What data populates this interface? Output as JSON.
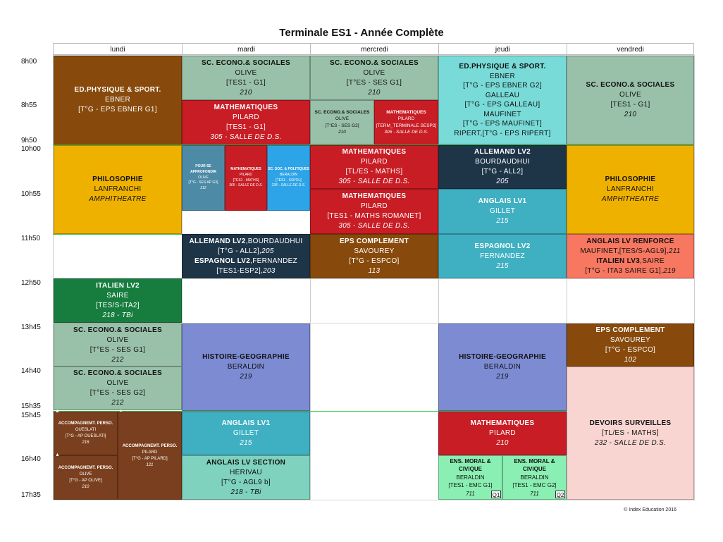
{
  "title": "Terminale ES1 - Année Complète",
  "days": [
    "lundi",
    "mardi",
    "mercredi",
    "jeudi",
    "vendredi"
  ],
  "times": [
    "8h00",
    "8h55",
    "9h50",
    "10h00",
    "10h55",
    "11h50",
    "12h50",
    "13h45",
    "14h40",
    "15h35",
    "15h45",
    "16h40",
    "17h35"
  ],
  "footer": "© Index Education 2016",
  "colors": {
    "brown": "#874a0c",
    "sage": "#99c1a9",
    "red": "#c81d25",
    "cyan": "#78dbd8",
    "gold": "#efb100",
    "steel": "#4d8aa6",
    "sky": "#2ea4e8",
    "navy": "#1e3548",
    "teal": "#3fb0c2",
    "salmon": "#f77761",
    "green": "#177d3f",
    "periwinkle": "#7d8bd3",
    "pink": "#f9d5d2",
    "mint": "#8aefb2",
    "dkbrown": "#7a3f1e",
    "aqua": "#7fd3be"
  },
  "events": {
    "mon_eps": [
      "ED.PHYSIQUE & SPORT.",
      "EBNER",
      "[T°G - EPS EBNER G1]"
    ],
    "mon_philo": [
      "PHILOSOPHIE",
      "LANFRANCHI",
      "AMPHITHEATRE"
    ],
    "mon_ital": [
      "ITALIEN LV2",
      "SAIRE",
      "[TES/S-ITA2]",
      "218 - TBi"
    ],
    "mon_ses1": [
      "SC. ECONO.& SOCIALES",
      "OLIVE",
      "[T°ES - SES G1]",
      "212"
    ],
    "mon_ses2": [
      "SC. ECONO.& SOCIALES",
      "OLIVE",
      "[T°ES - SES G2]",
      "212"
    ],
    "mon_ap1": [
      "ACCOMPAGNEMT. PERSO.",
      "OUESLATI",
      "[T°G - AP OUESLATI]",
      "216"
    ],
    "mon_ap2": [
      "ACCOMPAGNEMT. PERSO.",
      "PILARD",
      "[T°G - AP PILARD]",
      "121"
    ],
    "mon_ap3": [
      "ACCOMPAGNEMT. PERSO.",
      "OLIVE",
      "[T°G - AP OLIVE]",
      "210"
    ],
    "tue_ses": [
      "SC. ECONO.& SOCIALES",
      "OLIVE",
      "[TES1 - G1]",
      "210"
    ],
    "tue_math": [
      "MATHEMATIQUES",
      "PILARD",
      "[TES1 - G1]",
      "305 - SALLE DE D.S."
    ],
    "tue_appro": [
      "POUR SE APPROFONDIR",
      "OLIVE",
      "[T°G - SES AP G3]",
      "212"
    ],
    "tue_math2": [
      "MATHEMATIQUES",
      "PILARD",
      "[TES1 - MATHS]",
      "305 - SALLE DE D.S."
    ],
    "tue_scpol": [
      "SC. SOC. & POLITIQUES",
      "BERALDIN",
      "[TES1 - SSPOL]",
      "235 - SALLE DE D.S."
    ],
    "tue_lang_a": "ALLEMAND LV2",
    "tue_lang_b": ",BOURDAUDHUI",
    "tue_lang_c": "[T°G - ALL2],",
    "tue_lang_d": "205",
    "tue_lang_e": "ESPAGNOL LV2",
    "tue_lang_f": ",FERNANDEZ",
    "tue_lang_g": "[TES1-ESP2],",
    "tue_lang_h": "203",
    "tue_hg": [
      "HISTOIRE-GEOGRAPHIE",
      "BERALDIN",
      "219"
    ],
    "tue_ang": [
      "ANGLAIS LV1",
      "GILLET",
      "215"
    ],
    "tue_angs": [
      "ANGLAIS LV SECTION",
      "HERIVAU",
      "[T°G - AGL9 b]",
      "218 - TBi"
    ],
    "wed_ses": [
      "SC. ECONO.& SOCIALES",
      "OLIVE",
      "[T°ES - SES G1]",
      "210"
    ],
    "wed_ses2": [
      "SC. ECONO.& SOCIALES",
      "OLIVE",
      "[T°ES - SES G2]",
      "210"
    ],
    "wed_math": [
      "MATHEMATIQUES",
      "PILARD",
      "[TERM_TERMINALE SESP2]",
      "306 - SALLE DE D.S."
    ],
    "wed_math2": [
      "MATHEMATIQUES",
      "PILARD",
      "[TL/ES - MATHS]",
      "305 - SALLE DE D.S."
    ],
    "wed_math3": [
      "MATHEMATIQUES",
      "PILARD",
      "[TES1 - MATHS ROMANET]",
      "305 - SALLE DE D.S."
    ],
    "wed_eps": [
      "EPS COMPLEMENT",
      "SAVOUREY",
      "[T°G - ESPCO]",
      "113"
    ],
    "thu_eps": [
      "ED.PHYSIQUE & SPORT.",
      "EBNER",
      "[T°G - EPS EBNER G2]",
      "GALLEAU",
      "[T°G - EPS GALLEAU]",
      "MAUFINET",
      "[T°G - EPS MAUFINET]",
      "RIPERT,[T°G - EPS RIPERT]"
    ],
    "thu_all": [
      "ALLEMAND LV2",
      "BOURDAUDHUI",
      "[T°G - ALL2]",
      "205"
    ],
    "thu_ang": [
      "ANGLAIS LV1",
      "GILLET",
      "215"
    ],
    "thu_esp": [
      "ESPAGNOL LV2",
      "FERNANDEZ",
      "215"
    ],
    "thu_hg": [
      "HISTOIRE-GEOGRAPHIE",
      "BERALDIN",
      "219"
    ],
    "thu_math": [
      "MATHEMATIQUES",
      "PILARD",
      "210"
    ],
    "thu_emc1": [
      "ENS. MORAL & CIVIQUE",
      "BERALDIN",
      "[TES1 - EMC G1]",
      "711",
      "Q1"
    ],
    "thu_emc2": [
      "ENS. MORAL & CIVIQUE",
      "BERALDIN",
      "[TES1 - EMC G2]",
      "711",
      "Q2"
    ],
    "fri_ses": [
      "SC. ECONO.& SOCIALES",
      "OLIVE",
      "[TES1 - G1]",
      "210"
    ],
    "fri_philo": [
      "PHILOSOPHIE",
      "LANFRANCHI",
      "AMPHITHEATRE"
    ],
    "fri_ang_a": "ANGLAIS LV RENFORCE",
    "fri_ang_b": "MAUFINET,[TES/S-AGL9],",
    "fri_ang_c": "211",
    "fri_ang_d": "ITALIEN LV3",
    "fri_ang_e": ",SAIRE",
    "fri_ang_f": "[T°G - ITA3 SAIRE G1],",
    "fri_ang_g": "219",
    "fri_eps": [
      "EPS COMPLEMENT",
      "SAVOUREY",
      "[T°G - ESPCO]",
      "102"
    ],
    "fri_ds": [
      "DEVOIRS SURVEILLES",
      "[TL/ES - MATHS]",
      "232 - SALLE DE D.S."
    ]
  }
}
